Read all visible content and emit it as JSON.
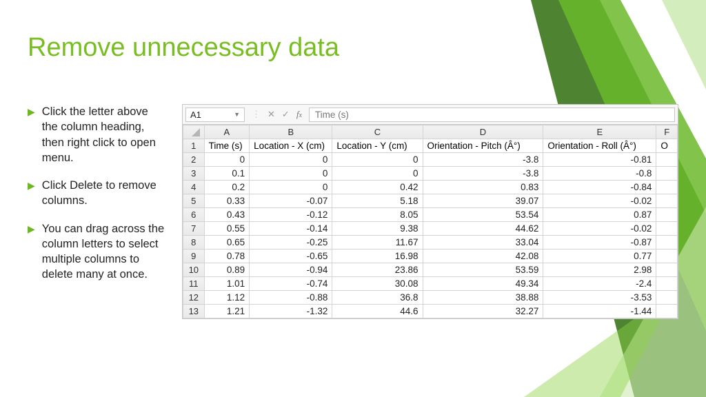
{
  "title": "Remove unnecessary data",
  "bullets": [
    "Click the letter above the column heading, then right click to open menu.",
    "Click Delete to remove columns.",
    "You can drag across the column letters to select multiple columns to delete many at once."
  ],
  "spreadsheet": {
    "cell_ref": "A1",
    "fx_value": "Time (s)",
    "col_headers": [
      "A",
      "B",
      "C",
      "D",
      "E"
    ],
    "col_partial": "F",
    "data_headers": [
      "Time (s)",
      "Location - X (cm)",
      "Location - Y (cm)",
      "Orientation - Pitch (Â°)",
      "Orientation - Roll (Â°)"
    ],
    "partial_header": "O",
    "rows": [
      {
        "n": 2,
        "c": [
          "0",
          "0",
          "0",
          "-3.8",
          "-0.81"
        ]
      },
      {
        "n": 3,
        "c": [
          "0.1",
          "0",
          "0",
          "-3.8",
          "-0.8"
        ]
      },
      {
        "n": 4,
        "c": [
          "0.2",
          "0",
          "0.42",
          "0.83",
          "-0.84"
        ]
      },
      {
        "n": 5,
        "c": [
          "0.33",
          "-0.07",
          "5.18",
          "39.07",
          "-0.02"
        ]
      },
      {
        "n": 6,
        "c": [
          "0.43",
          "-0.12",
          "8.05",
          "53.54",
          "0.87"
        ]
      },
      {
        "n": 7,
        "c": [
          "0.55",
          "-0.14",
          "9.38",
          "44.62",
          "-0.02"
        ]
      },
      {
        "n": 8,
        "c": [
          "0.65",
          "-0.25",
          "11.67",
          "33.04",
          "-0.87"
        ]
      },
      {
        "n": 9,
        "c": [
          "0.78",
          "-0.65",
          "16.98",
          "42.08",
          "0.77"
        ]
      },
      {
        "n": 10,
        "c": [
          "0.89",
          "-0.94",
          "23.86",
          "53.59",
          "2.98"
        ]
      },
      {
        "n": 11,
        "c": [
          "1.01",
          "-0.74",
          "30.08",
          "49.34",
          "-2.4"
        ]
      },
      {
        "n": 12,
        "c": [
          "1.12",
          "-0.88",
          "36.8",
          "38.88",
          "-3.53"
        ]
      },
      {
        "n": 13,
        "c": [
          "1.21",
          "-1.32",
          "44.6",
          "32.27",
          "-1.44"
        ]
      }
    ]
  }
}
